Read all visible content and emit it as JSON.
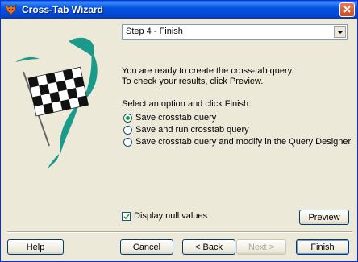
{
  "window": {
    "title": "Cross-Tab Wizard",
    "icon": "wizard-fox-icon"
  },
  "step": {
    "selected": "Step 4 - Finish"
  },
  "intro": {
    "line1": "You are ready to create the cross-tab query.",
    "line2": "To check your results, click Preview."
  },
  "options": {
    "heading": "Select an option and click Finish:",
    "items": [
      {
        "label": "Save crosstab query",
        "selected": true
      },
      {
        "label": "Save and run crosstab query",
        "selected": false
      },
      {
        "label": "Save crosstab query and modify in the Query Designer",
        "selected": false
      }
    ]
  },
  "display_null": {
    "label": "Display null values",
    "checked": true
  },
  "buttons": {
    "preview": "Preview",
    "help": "Help",
    "cancel": "Cancel",
    "back": "< Back",
    "next": "Next >",
    "finish": "Finish"
  },
  "colors": {
    "titlebar": "#0553e1",
    "dialog_bg": "#ece9d8",
    "flag_swoosh": "#1a9a8a"
  }
}
